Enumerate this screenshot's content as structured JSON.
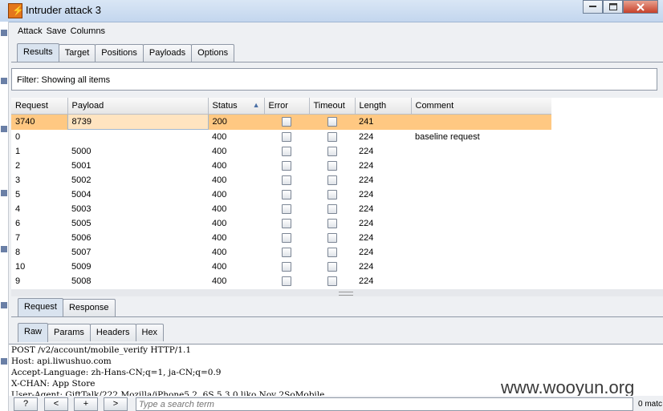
{
  "window": {
    "title": "Intruder attack 3"
  },
  "menu": [
    "Attack",
    "Save",
    "Columns"
  ],
  "main_tabs": [
    "Results",
    "Target",
    "Positions",
    "Payloads",
    "Options"
  ],
  "filter_text": "Filter: Showing all items",
  "columns": [
    "Request",
    "Payload",
    "Status",
    "Error",
    "Timeout",
    "Length",
    "Comment"
  ],
  "rows": [
    {
      "request": "3740",
      "payload": "8739",
      "status": "200",
      "length": "241",
      "comment": "",
      "selected": true
    },
    {
      "request": "0",
      "payload": "",
      "status": "400",
      "length": "224",
      "comment": "baseline request"
    },
    {
      "request": "1",
      "payload": "5000",
      "status": "400",
      "length": "224",
      "comment": ""
    },
    {
      "request": "2",
      "payload": "5001",
      "status": "400",
      "length": "224",
      "comment": ""
    },
    {
      "request": "3",
      "payload": "5002",
      "status": "400",
      "length": "224",
      "comment": ""
    },
    {
      "request": "5",
      "payload": "5004",
      "status": "400",
      "length": "224",
      "comment": ""
    },
    {
      "request": "4",
      "payload": "5003",
      "status": "400",
      "length": "224",
      "comment": ""
    },
    {
      "request": "6",
      "payload": "5005",
      "status": "400",
      "length": "224",
      "comment": ""
    },
    {
      "request": "7",
      "payload": "5006",
      "status": "400",
      "length": "224",
      "comment": ""
    },
    {
      "request": "8",
      "payload": "5007",
      "status": "400",
      "length": "224",
      "comment": ""
    },
    {
      "request": "10",
      "payload": "5009",
      "status": "400",
      "length": "224",
      "comment": ""
    },
    {
      "request": "9",
      "payload": "5008",
      "status": "400",
      "length": "224",
      "comment": ""
    }
  ],
  "req_tabs": [
    "Request",
    "Response"
  ],
  "view_tabs": [
    "Raw",
    "Params",
    "Headers",
    "Hex"
  ],
  "request_lines": [
    "POST /v2/account/mobile_verify HTTP/1.1",
    "Host: api.liwushuo.com",
    "Accept-Language: zh-Hans-CN;q=1, ja-CN;q=0.9",
    "X-CHAN: App Store",
    "User-Agent: GiftTalk/222 Mozilla/iPhone5,2  6S 5.3.0 liko Nov 2SoMobile"
  ],
  "bottom": {
    "help": "?",
    "prev": "<",
    "add": "+",
    "next": ">",
    "search_placeholder": "Type a search term",
    "matches": "0 matc"
  },
  "watermark": "www.wooyun.org"
}
